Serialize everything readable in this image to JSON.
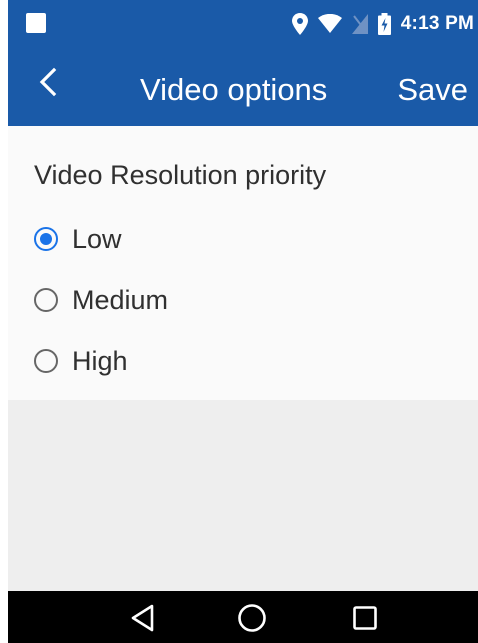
{
  "status_bar": {
    "time": "4:13 PM",
    "icons": [
      "notification-square-icon",
      "location-icon",
      "wifi-icon",
      "no-sim-icon",
      "battery-charging-icon"
    ]
  },
  "toolbar": {
    "back_icon": "chevron-left-icon",
    "title": "Video options",
    "save_label": "Save"
  },
  "settings": {
    "section_title": "Video Resolution priority",
    "options": [
      {
        "label": "Low",
        "selected": true
      },
      {
        "label": "Medium",
        "selected": false
      },
      {
        "label": "High",
        "selected": false
      }
    ]
  },
  "nav_bar": {
    "buttons": [
      "back-triangle-icon",
      "home-circle-icon",
      "recents-square-icon"
    ]
  },
  "colors": {
    "app_bar": "#1a5aa8",
    "accent": "#1a73e8",
    "panel": "#fafafa",
    "background": "#eeeeee",
    "nav_bar": "#000000"
  }
}
